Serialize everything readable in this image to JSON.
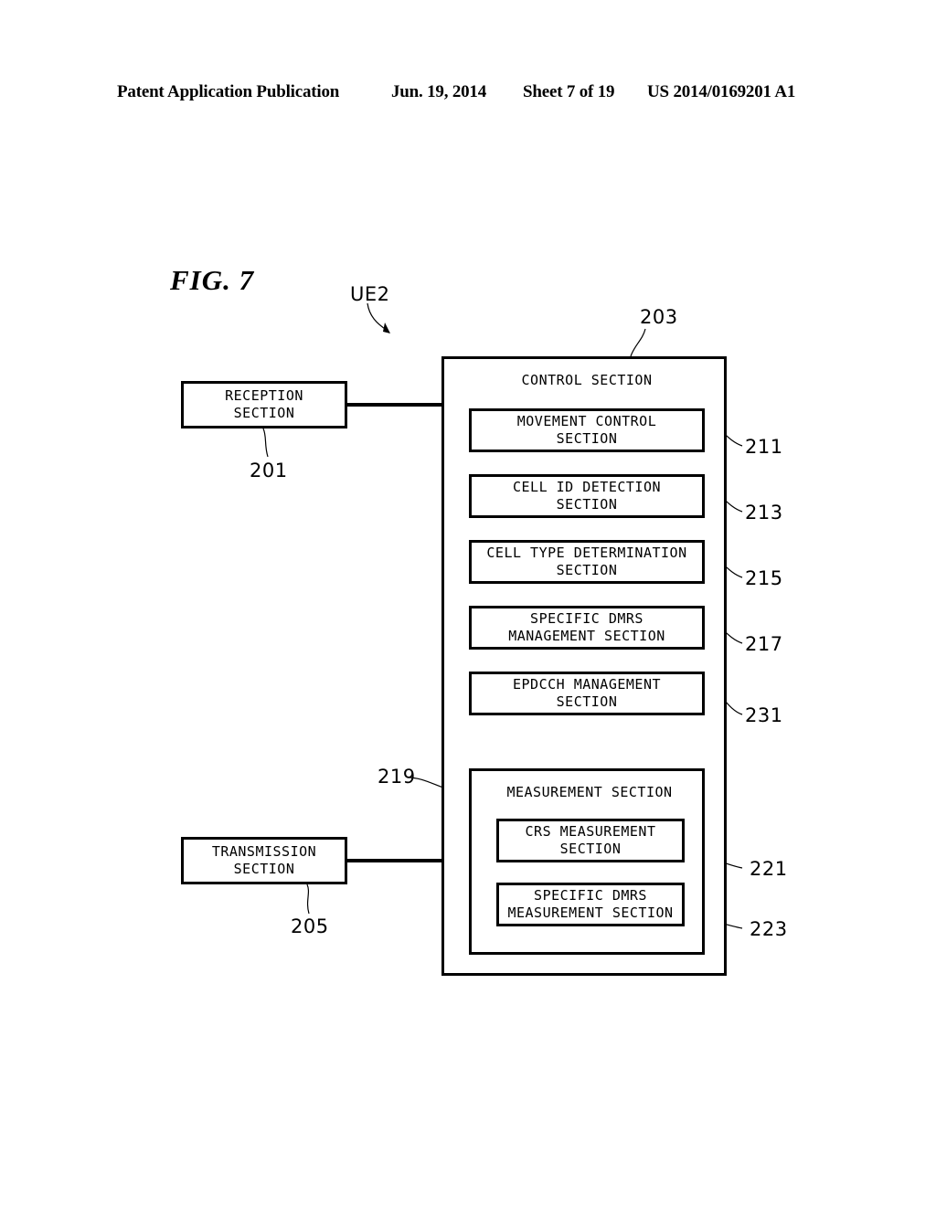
{
  "header": {
    "publication": "Patent Application Publication",
    "date": "Jun. 19, 2014",
    "sheet": "Sheet 7 of 19",
    "patent_number": "US 2014/0169201 A1"
  },
  "figure": {
    "label": "FIG. 7",
    "device_label": "UE2"
  },
  "diagram": {
    "reception_section": {
      "label": "RECEPTION\nSECTION",
      "ref": "201"
    },
    "transmission_section": {
      "label": "TRANSMISSION\nSECTION",
      "ref": "205"
    },
    "control_section": {
      "label": "CONTROL SECTION",
      "ref": "203",
      "blocks": [
        {
          "label": "MOVEMENT CONTROL\nSECTION",
          "ref": "211"
        },
        {
          "label": "CELL ID DETECTION\nSECTION",
          "ref": "213"
        },
        {
          "label": "CELL TYPE DETERMINATION\nSECTION",
          "ref": "215"
        },
        {
          "label": "SPECIFIC DMRS\nMANAGEMENT SECTION",
          "ref": "217"
        },
        {
          "label": "EPDCCH MANAGEMENT\nSECTION",
          "ref": "231"
        }
      ],
      "measurement_section": {
        "label": "MEASUREMENT SECTION",
        "ref": "219",
        "blocks": [
          {
            "label": "CRS MEASUREMENT\nSECTION",
            "ref": "221"
          },
          {
            "label": "SPECIFIC DMRS\nMEASUREMENT SECTION",
            "ref": "223"
          }
        ]
      }
    }
  },
  "colors": {
    "ink": "#000000",
    "paper": "#ffffff"
  }
}
